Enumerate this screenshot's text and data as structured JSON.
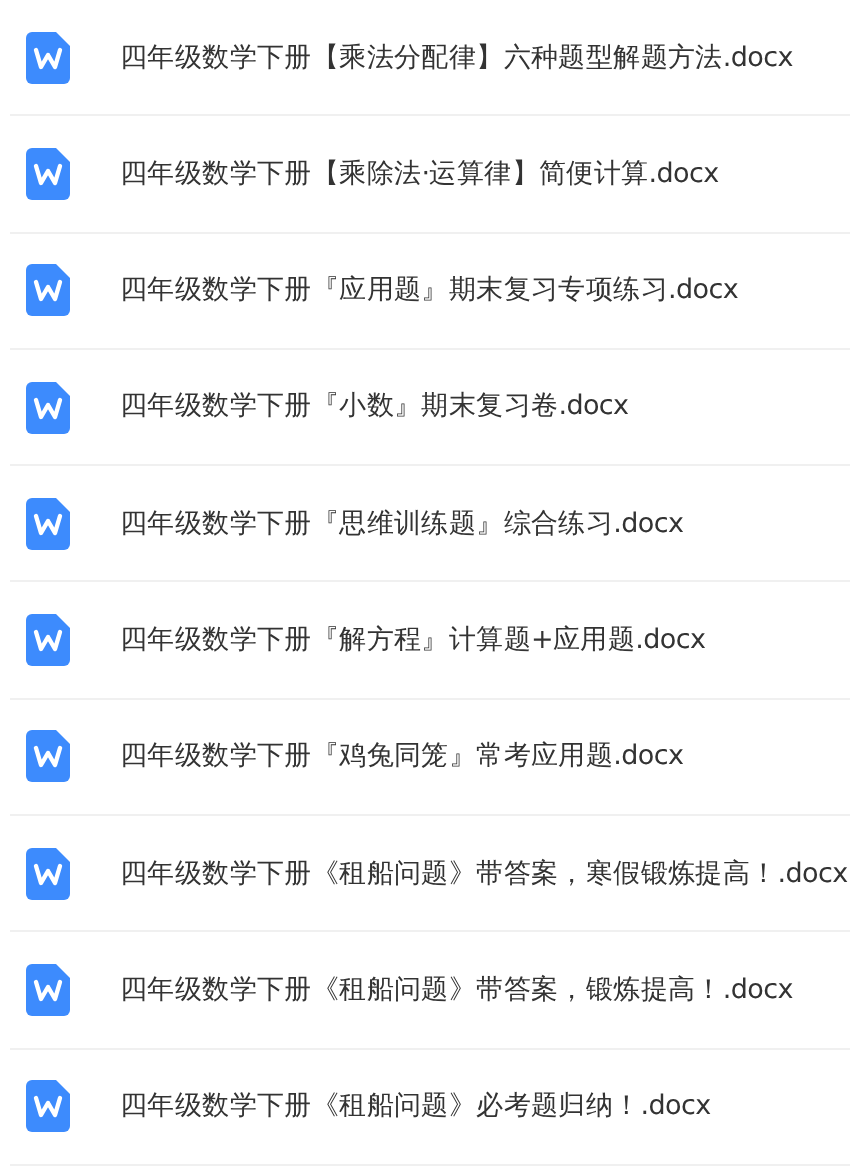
{
  "files": [
    {
      "name": "四年级数学下册【乘法分配律】六种题型解题方法.docx"
    },
    {
      "name": "四年级数学下册【乘除法·运算律】简便计算.docx"
    },
    {
      "name": "四年级数学下册『应用题』期末复习专项练习.docx"
    },
    {
      "name": "四年级数学下册『小数』期末复习卷.docx"
    },
    {
      "name": "四年级数学下册『思维训练题』综合练习.docx"
    },
    {
      "name": "四年级数学下册『解方程』计算题+应用题.docx"
    },
    {
      "name": "四年级数学下册『鸡兔同笼』常考应用题.docx"
    },
    {
      "name": "四年级数学下册《租船问题》带答案，寒假锻炼提高！.docx"
    },
    {
      "name": "四年级数学下册《租船问题》带答案，锻炼提高！.docx"
    },
    {
      "name": "四年级数学下册《租船问题》必考题归纳！.docx"
    }
  ]
}
